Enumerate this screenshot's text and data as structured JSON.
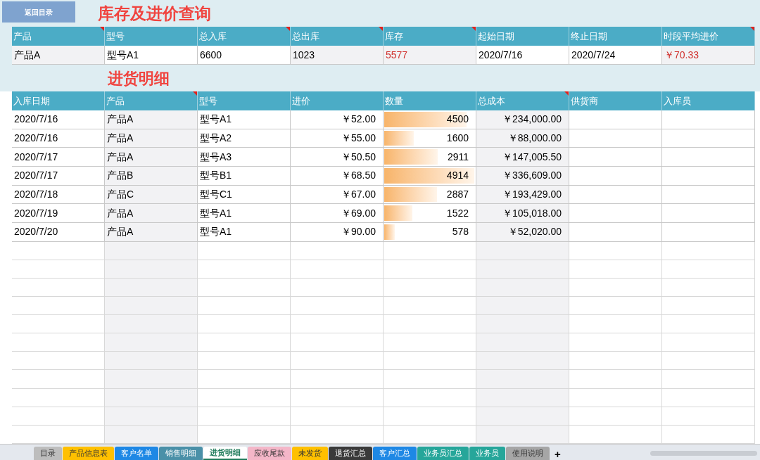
{
  "back_button": "返回目录",
  "summary": {
    "title": "库存及进价查询",
    "columns": [
      {
        "label": "产品",
        "comment": true,
        "shaded": true
      },
      {
        "label": "型号",
        "comment": false,
        "shaded": false
      },
      {
        "label": "总入库",
        "comment": true,
        "shaded": false
      },
      {
        "label": "总出库",
        "comment": true,
        "shaded": true
      },
      {
        "label": "库存",
        "comment": true,
        "shaded": true
      },
      {
        "label": "起始日期",
        "comment": false,
        "shaded": false
      },
      {
        "label": "终止日期",
        "comment": false,
        "shaded": false
      },
      {
        "label": "时段平均进价",
        "comment": true,
        "shaded": true
      }
    ],
    "values": [
      {
        "text": "产品A",
        "highlight": false
      },
      {
        "text": "型号A1",
        "highlight": false
      },
      {
        "text": "6600",
        "highlight": false
      },
      {
        "text": "1023",
        "highlight": false
      },
      {
        "text": "5577",
        "highlight": true
      },
      {
        "text": "2020/7/16",
        "highlight": false
      },
      {
        "text": "2020/7/24",
        "highlight": false
      },
      {
        "text": "￥70.33",
        "highlight": true
      }
    ]
  },
  "detail": {
    "title": "进货明细",
    "columns": [
      {
        "label": "入库日期",
        "comment": false,
        "shaded": false,
        "kind": "text"
      },
      {
        "label": "产品",
        "comment": true,
        "shaded": true,
        "kind": "text"
      },
      {
        "label": "型号",
        "comment": false,
        "shaded": false,
        "kind": "text"
      },
      {
        "label": "进价",
        "comment": false,
        "shaded": false,
        "kind": "number"
      },
      {
        "label": "数量",
        "comment": false,
        "shaded": false,
        "kind": "bar"
      },
      {
        "label": "总成本",
        "comment": true,
        "shaded": true,
        "kind": "number"
      },
      {
        "label": "供货商",
        "comment": false,
        "shaded": false,
        "kind": "text"
      },
      {
        "label": "入库员",
        "comment": false,
        "shaded": false,
        "kind": "text"
      }
    ],
    "rows": [
      {
        "date": "2020/7/16",
        "product": "产品A",
        "model": "型号A1",
        "price": "￥52.00",
        "qty": "4500",
        "level": 0.916,
        "cost": "￥234,000.00"
      },
      {
        "date": "2020/7/16",
        "product": "产品A",
        "model": "型号A2",
        "price": "￥55.00",
        "qty": "1600",
        "level": 0.326,
        "cost": "￥88,000.00"
      },
      {
        "date": "2020/7/17",
        "product": "产品A",
        "model": "型号A3",
        "price": "￥50.50",
        "qty": "2911",
        "level": 0.592,
        "cost": "￥147,005.50"
      },
      {
        "date": "2020/7/17",
        "product": "产品B",
        "model": "型号B1",
        "price": "￥68.50",
        "qty": "4914",
        "level": 1,
        "cost": "￥336,609.00"
      },
      {
        "date": "2020/7/18",
        "product": "产品C",
        "model": "型号C1",
        "price": "￥67.00",
        "qty": "2887",
        "level": 0.588,
        "cost": "￥193,429.00"
      },
      {
        "date": "2020/7/19",
        "product": "产品A",
        "model": "型号A1",
        "price": "￥69.00",
        "qty": "1522",
        "level": 0.31,
        "cost": "￥105,018.00"
      },
      {
        "date": "2020/7/20",
        "product": "产品A",
        "model": "型号A1",
        "price": "￥90.00",
        "qty": "578",
        "level": 0.118,
        "cost": "￥52,020.00"
      }
    ]
  },
  "sheet_tabs": [
    {
      "label": "目录",
      "selected": false,
      "color": "#bdbdbd"
    },
    {
      "label": "产品信息表",
      "selected": false,
      "color": "#ffc000"
    },
    {
      "label": "客户名单",
      "selected": false,
      "color": "#1e88e5"
    },
    {
      "label": "销售明细",
      "selected": false,
      "color": "#4a90a8"
    },
    {
      "label": "进货明细",
      "selected": true,
      "color": "#ffffff"
    },
    {
      "label": "应收尾款",
      "selected": false,
      "color": "#f4b6c8"
    },
    {
      "label": "未发货",
      "selected": false,
      "color": "#ffc000"
    },
    {
      "label": "退货汇总",
      "selected": false,
      "color": "#3a3a3a"
    },
    {
      "label": "客户汇总",
      "selected": false,
      "color": "#1e88e5"
    },
    {
      "label": "业务员汇总",
      "selected": false,
      "color": "#26a69a"
    },
    {
      "label": "业务员",
      "selected": false,
      "color": "#26a69a"
    },
    {
      "label": "使用说明",
      "selected": false,
      "color": "#a6a6a6"
    }
  ],
  "add_sheet": "+"
}
